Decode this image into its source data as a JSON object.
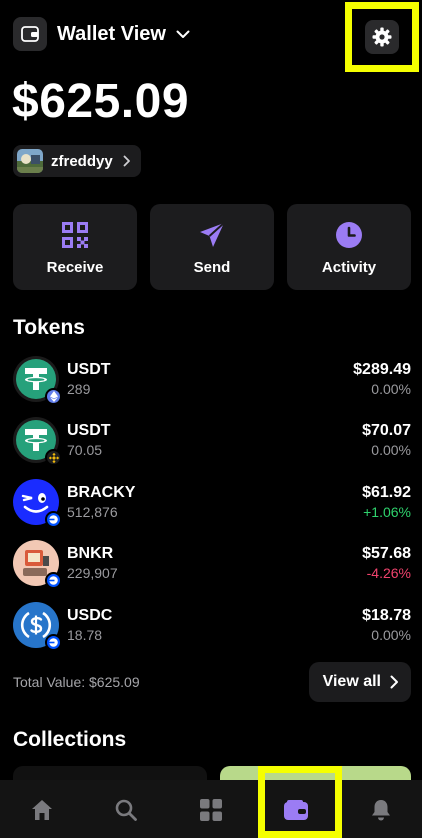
{
  "header": {
    "wallet_title": "Wallet View"
  },
  "balance": "$625.09",
  "user": {
    "name": "zfreddyy"
  },
  "actions": [
    {
      "label": "Receive",
      "icon": "qr-code-icon"
    },
    {
      "label": "Send",
      "icon": "paper-plane-icon"
    },
    {
      "label": "Activity",
      "icon": "clock-icon"
    }
  ],
  "tokens_section": {
    "title": "Tokens"
  },
  "tokens": [
    {
      "symbol": "USDT",
      "amount": "289",
      "value": "$289.49",
      "change": "0.00%",
      "change_color": "#9a9a9e",
      "chain": "ethereum-badge"
    },
    {
      "symbol": "USDT",
      "amount": "70.05",
      "value": "$70.07",
      "change": "0.00%",
      "change_color": "#9a9a9e",
      "chain": "bnb-badge"
    },
    {
      "symbol": "BRACKY",
      "amount": "512,876",
      "value": "$61.92",
      "change": "+1.06%",
      "change_color": "#2fd26d",
      "chain": "base-badge"
    },
    {
      "symbol": "BNKR",
      "amount": "229,907",
      "value": "$57.68",
      "change": "-4.26%",
      "change_color": "#f0436d",
      "chain": "base-badge"
    },
    {
      "symbol": "USDC",
      "amount": "18.78",
      "value": "$18.78",
      "change": "0.00%",
      "change_color": "#9a9a9e",
      "chain": "base-badge"
    }
  ],
  "total": {
    "text": "Total Value: $625.09"
  },
  "view_all": {
    "label": "View all"
  },
  "collections_section": {
    "title": "Collections"
  },
  "tabbar": {
    "items": [
      {
        "name": "home",
        "active": false
      },
      {
        "name": "search",
        "active": false
      },
      {
        "name": "apps",
        "active": false
      },
      {
        "name": "wallet",
        "active": true
      },
      {
        "name": "notifications",
        "active": false
      }
    ]
  },
  "colors": {
    "accent": "#9b7cf4",
    "positive": "#2fd26d",
    "negative": "#f0436d",
    "highlight": "#f5ff00",
    "tether": "#26a17b",
    "usdc": "#2775ca"
  }
}
